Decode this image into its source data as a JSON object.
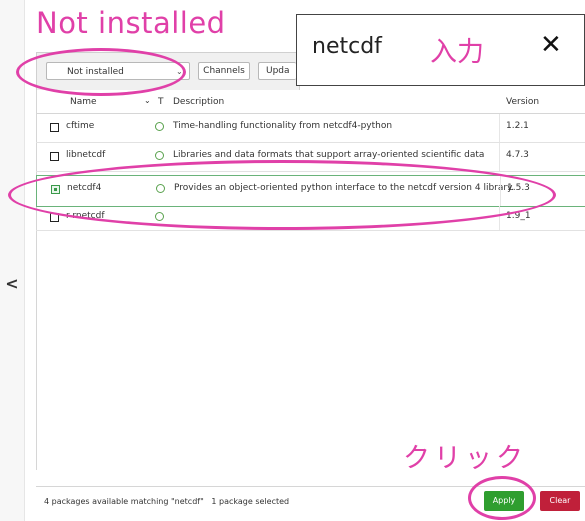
{
  "annotations": {
    "title": "Not installed",
    "input_label": "入力",
    "click_label": "クリック"
  },
  "toolbar": {
    "filter_value": "Not installed",
    "channels_label": "Channels",
    "update_label": "Upda"
  },
  "search": {
    "query": "netcdf",
    "close_symbol": "✕"
  },
  "sidebar": {
    "collapse_symbol": "<"
  },
  "table": {
    "columns": {
      "name": "Name",
      "type": "T",
      "description": "Description",
      "version": "Version"
    },
    "rows": [
      {
        "name": "cftime",
        "description": "Time-handling functionality from netcdf4-python",
        "version": "1.2.1"
      },
      {
        "name": "libnetcdf",
        "description": "Libraries and data formats that support array-oriented scientific data",
        "version": "4.7.3"
      },
      {
        "name": "netcdf4",
        "description": "Provides an object-oriented python interface to the netcdf version 4 library.",
        "version": "1.5.3"
      },
      {
        "name": "r-rnetcdf",
        "description": "",
        "version": "1.9_1"
      }
    ]
  },
  "footer": {
    "status": "4 packages available matching \"netcdf\"   1 package selected",
    "apply_label": "Apply",
    "clear_label": "Clear"
  },
  "colors": {
    "annotation": "#e040a8",
    "apply": "#2f9e2f",
    "clear": "#c0203a",
    "status_ring": "#5aa24e"
  }
}
